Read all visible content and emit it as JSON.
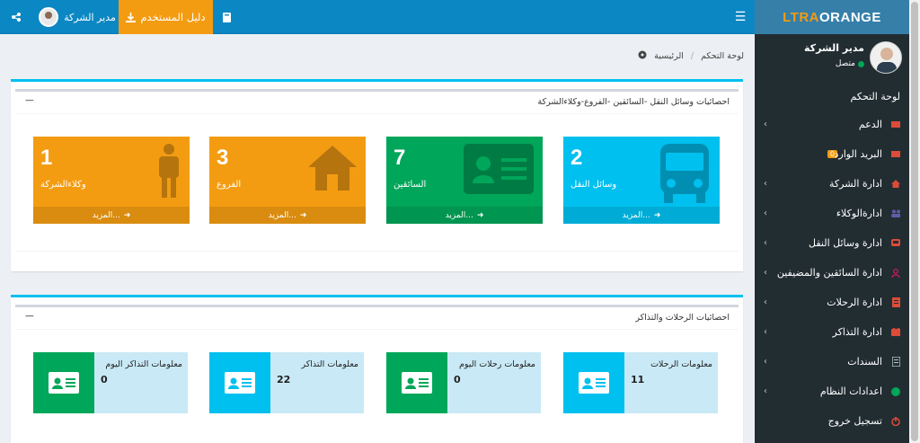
{
  "topbar": {
    "menu_icon": "hamburger-icon",
    "guide_label": "دليل المستخدم",
    "user_name": "مدير الشركة",
    "share_icon": "share-icon"
  },
  "sidebar": {
    "logo_part1": "LTRA",
    "logo_part2": "ORANGE",
    "user_name": "مدير الشركة",
    "user_status": "متصل",
    "items": [
      {
        "label": "لوحة التحكم",
        "icon": "",
        "has_children": false
      },
      {
        "label": "الدعم",
        "icon": "envelope-icon",
        "color": "#dd4b39",
        "has_children": true
      },
      {
        "label": "البريد الوارد",
        "icon": "envelope-icon",
        "color": "#dd4b39",
        "badge": "0",
        "has_children": false
      },
      {
        "label": "ادارة الشركة",
        "icon": "home-icon",
        "color": "#dd4b39",
        "has_children": true
      },
      {
        "label": "ادارةالوكلاء",
        "icon": "users-icon",
        "color": "#605ca8",
        "has_children": true
      },
      {
        "label": "ادارة وسائل النقل",
        "icon": "bus-icon",
        "color": "#dd4b39",
        "has_children": true
      },
      {
        "label": "ادارة السائقين والمضيفين",
        "icon": "user-icon",
        "color": "#d81b60",
        "has_children": true
      },
      {
        "label": "ادارة الرحلات",
        "icon": "file-icon",
        "color": "#dd4b39",
        "has_children": true
      },
      {
        "label": "ادارة التذاكر",
        "icon": "ticket-icon",
        "color": "#dd4b39",
        "has_children": true
      },
      {
        "label": "السندات",
        "icon": "document-icon",
        "color": "#b8c7ce",
        "has_children": true
      },
      {
        "label": "اعدادات النظام",
        "icon": "circle-icon",
        "color": "#00a65a",
        "has_children": true
      },
      {
        "label": "تسجيل خروج",
        "icon": "power-icon",
        "color": "#dd4b39",
        "has_children": false
      }
    ]
  },
  "breadcrumb": {
    "home": "الرئيسية",
    "current": "لوحة التحكم"
  },
  "box1": {
    "title": "احصائيات وسائل النقل -السائقين -الفروع-وكلاءالشركة",
    "cards": [
      {
        "value": "2",
        "label": "وسائل النقل",
        "more": "المزيد...",
        "color": "#00c0ef",
        "icon": "bus-icon"
      },
      {
        "value": "7",
        "label": "السائقين",
        "more": "المزيد...",
        "color": "#00a65a",
        "icon": "id-card-icon"
      },
      {
        "value": "3",
        "label": "الفروع",
        "more": "المزيد...",
        "color": "#f39c12",
        "icon": "home-icon"
      },
      {
        "value": "1",
        "label": "وكلاءالشركة",
        "more": "المزيد...",
        "color": "#f39c12",
        "icon": "person-icon"
      }
    ]
  },
  "box2": {
    "title": "احصائيات الرحلات والتذاكر",
    "cards": [
      {
        "label": "معلومات الرحلات",
        "value": "11",
        "color": "#00c0ef"
      },
      {
        "label": "معلومات رحلات اليوم",
        "value": "0",
        "color": "#00a65a"
      },
      {
        "label": "معلومات التذاكر",
        "value": "22",
        "color": "#00c0ef"
      },
      {
        "label": "معلومات التذاكر اليوم",
        "value": "0",
        "color": "#00a65a"
      }
    ]
  }
}
